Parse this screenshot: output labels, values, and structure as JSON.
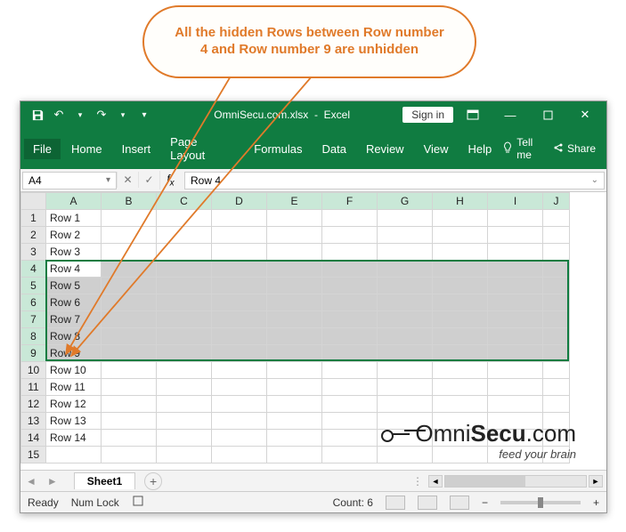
{
  "callout": {
    "text": "All the hidden Rows between  Row number 4 and Row number 9 are unhidden"
  },
  "titlebar": {
    "filename": "OmniSecu.com.xlsx",
    "appname": "Excel",
    "signin": "Sign in"
  },
  "ribbon": {
    "file": "File",
    "tabs": [
      "Home",
      "Insert",
      "Page Layout",
      "Formulas",
      "Data",
      "Review",
      "View",
      "Help"
    ],
    "tellme": "Tell me",
    "share": "Share"
  },
  "formula": {
    "namebox": "A4",
    "value": "Row 4"
  },
  "grid": {
    "columns": [
      "A",
      "B",
      "C",
      "D",
      "E",
      "F",
      "G",
      "H",
      "I",
      "J"
    ],
    "rows": [
      {
        "n": 1,
        "a": "Row 1",
        "sel": false
      },
      {
        "n": 2,
        "a": "Row 2",
        "sel": false
      },
      {
        "n": 3,
        "a": "Row 3",
        "sel": false
      },
      {
        "n": 4,
        "a": "Row 4",
        "sel": true,
        "active": true
      },
      {
        "n": 5,
        "a": "Row 5",
        "sel": true
      },
      {
        "n": 6,
        "a": "Row 6",
        "sel": true
      },
      {
        "n": 7,
        "a": "Row 7",
        "sel": true
      },
      {
        "n": 8,
        "a": "Row 8",
        "sel": true
      },
      {
        "n": 9,
        "a": "Row 9",
        "sel": true
      },
      {
        "n": 10,
        "a": "Row 10",
        "sel": false
      },
      {
        "n": 11,
        "a": "Row 11",
        "sel": false
      },
      {
        "n": 12,
        "a": "Row 12",
        "sel": false
      },
      {
        "n": 13,
        "a": "Row 13",
        "sel": false
      },
      {
        "n": 14,
        "a": "Row 14",
        "sel": false
      },
      {
        "n": 15,
        "a": "",
        "sel": false
      }
    ]
  },
  "tabs": {
    "sheet": "Sheet1"
  },
  "status": {
    "ready": "Ready",
    "numlock": "Num Lock",
    "count_label": "Count:",
    "count_value": "6",
    "zoom": "100%"
  },
  "logo": {
    "main_a": "Omni",
    "main_b": "Secu",
    "main_c": ".com",
    "sub": "feed your brain"
  }
}
